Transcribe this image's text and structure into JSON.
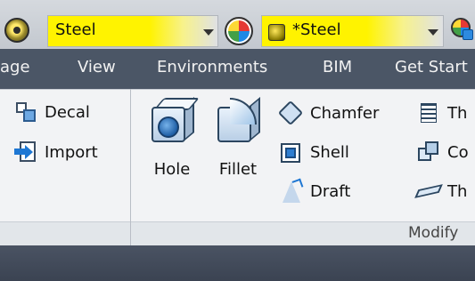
{
  "toolbar": {
    "material_value": "Steel",
    "appearance_value": "*Steel",
    "colors": {
      "highlight": "#fff300",
      "ribbon_tabs_bg": "#4b5666"
    },
    "icons": {
      "material": "material-sphere-icon",
      "appearance": "appearance-browser-icon",
      "clear_appearance": "clear-appearance-icon"
    }
  },
  "tabs": [
    "age",
    "View",
    "Environments",
    "BIM",
    "Get Start"
  ],
  "panel": {
    "left_buttons": [
      {
        "label": "Decal",
        "icon": "decal-icon"
      },
      {
        "label": "Import",
        "icon": "import-icon"
      }
    ],
    "big_buttons": [
      {
        "label": "Hole",
        "icon": "hole-icon"
      },
      {
        "label": "Fillet",
        "icon": "fillet-icon"
      }
    ],
    "mid_buttons": [
      {
        "label": "Chamfer",
        "icon": "chamfer-icon"
      },
      {
        "label": "Shell",
        "icon": "shell-icon"
      },
      {
        "label": "Draft",
        "icon": "draft-icon"
      }
    ],
    "right_buttons": [
      {
        "label": "Th",
        "icon": "thread-icon"
      },
      {
        "label": "Co",
        "icon": "combine-icon"
      },
      {
        "label": "Th",
        "icon": "thicken-icon"
      }
    ],
    "group_label": "Modify"
  }
}
